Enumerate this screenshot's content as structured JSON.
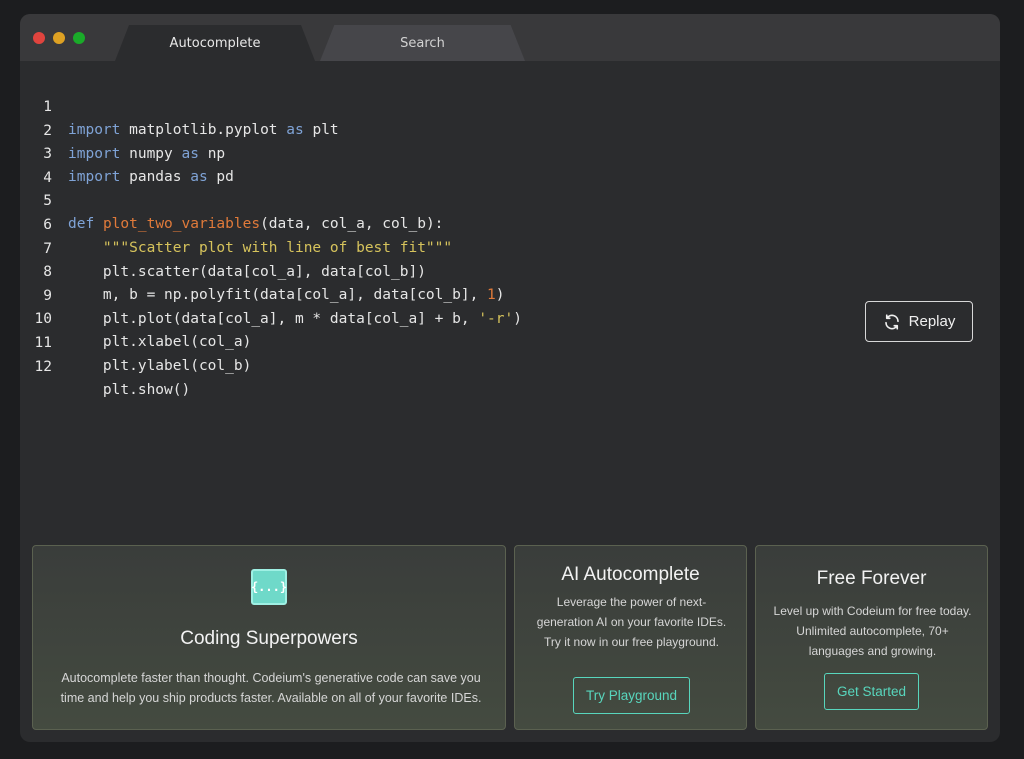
{
  "tabs": [
    {
      "label": "Autocomplete",
      "active": true
    },
    {
      "label": "Search",
      "active": false
    }
  ],
  "code": {
    "lines": [
      {
        "num": "1"
      },
      {
        "num": "2"
      },
      {
        "num": "3"
      },
      {
        "num": "4"
      },
      {
        "num": "5"
      },
      {
        "num": "6"
      },
      {
        "num": "7"
      },
      {
        "num": "8"
      },
      {
        "num": "9"
      },
      {
        "num": "10"
      },
      {
        "num": "11"
      },
      {
        "num": "12"
      }
    ],
    "t": {
      "import": "import",
      "as": "as",
      "def": "def",
      "l1_mod": " matplotlib.pyplot ",
      "l1_alias": " plt",
      "l2_mod": " numpy ",
      "l2_alias": " np",
      "l3_mod": " pandas ",
      "l3_alias": " pd",
      "l5_fn": "plot_two_variables",
      "l5_args": "(data, col_a, col_b):",
      "l6_doc": "\"\"\"Scatter plot with line of best fit\"\"\"",
      "l7": "plt.scatter(data[col_a], data[col_b])",
      "l8_pre": "m, b = np.polyfit(data[col_a], data[col_b], ",
      "l8_num": "1",
      "l8_post": ")",
      "l9_pre": "plt.plot(data[col_a], m * data[col_a] + b, ",
      "l9_str": "'-r'",
      "l9_post": ")",
      "l10": "plt.xlabel(col_a)",
      "l11": "plt.ylabel(col_b)",
      "l12": "plt.show()"
    }
  },
  "replay": {
    "label": "Replay",
    "icon": "refresh-icon"
  },
  "cards": {
    "coding": {
      "icon_glyph": "{...}",
      "title": "Coding Superpowers",
      "desc": "Autocomplete faster than thought. Codeium's generative code can save you time and help you ship products faster. Available on all of your favorite IDEs."
    },
    "ai": {
      "title": "AI Autocomplete",
      "desc": "Leverage the power of next-generation AI on your favorite IDEs. Try it now in our free playground.",
      "cta": "Try Playground"
    },
    "free": {
      "title": "Free Forever",
      "desc": "Level up with Codeium for free today. Unlimited autocomplete, 70+ languages and growing.",
      "cta": "Get Started"
    }
  },
  "colors": {
    "keyword": "#7fa3d6",
    "function": "#e07a3a",
    "string": "#d6c35c",
    "accent": "#58d6bd"
  }
}
